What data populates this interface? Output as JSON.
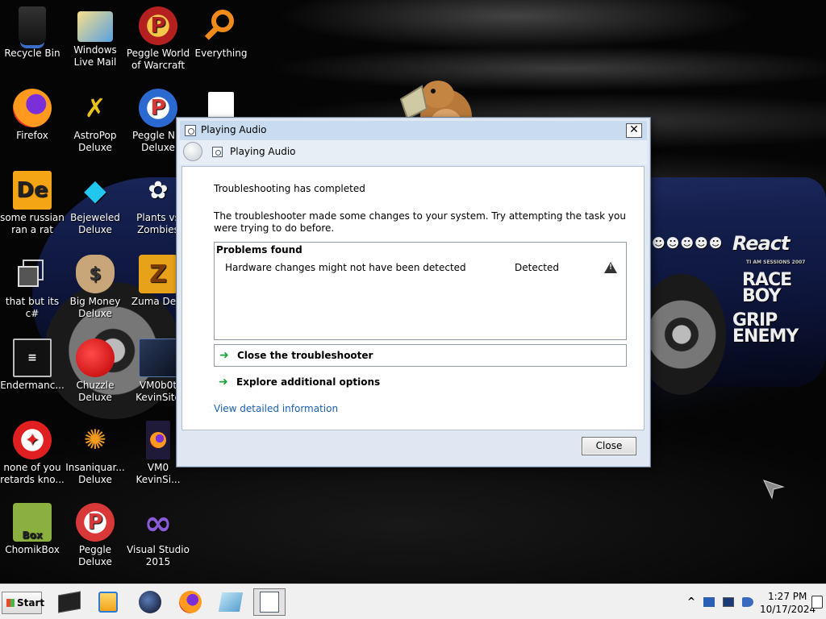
{
  "desktop": {
    "icons": [
      {
        "label": "Recycle Bin",
        "icon": "recycle-bin-icon"
      },
      {
        "label": "Windows Live Mail",
        "icon": "mail-icon"
      },
      {
        "label": "Peggle World of Warcraft ...",
        "icon": "peggle-icon"
      },
      {
        "label": "Everything",
        "icon": "search-icon"
      },
      {
        "label": "Firefox",
        "icon": "firefox-icon"
      },
      {
        "label": "AstroPop Deluxe",
        "icon": "astropop-icon"
      },
      {
        "label": "Peggle Nig Deluxe",
        "icon": "peggle-icon"
      },
      {
        "label": "some russian ran a rat",
        "icon": "de-app-icon"
      },
      {
        "label": "Bejeweled Deluxe",
        "icon": "gem-icon"
      },
      {
        "label": "Plants vs Zombies",
        "icon": "plant-icon"
      },
      {
        "label": "that but its c#",
        "icon": "windows-stack-icon"
      },
      {
        "label": "Big Money Deluxe",
        "icon": "money-bag-icon"
      },
      {
        "label": "Zuma Delu",
        "icon": "zuma-icon"
      },
      {
        "label": "Endermanc...",
        "icon": "terminal-icon"
      },
      {
        "label": "Chuzzle Deluxe",
        "icon": "chuzzle-icon"
      },
      {
        "label": "VM0b0t KevinSite",
        "icon": "vm-icon"
      },
      {
        "label": "none of you retards kno...",
        "icon": "dragon-icon"
      },
      {
        "label": "Insaniquar... Deluxe",
        "icon": "fish-icon"
      },
      {
        "label": "VM0 KevinSi...",
        "icon": "firefox-file-icon"
      },
      {
        "label": "ChomikBox",
        "icon": "chomikbox-icon"
      },
      {
        "label": "Peggle Deluxe",
        "icon": "peggle-icon"
      },
      {
        "label": "Visual Studio 2015",
        "icon": "visual-studio-icon"
      }
    ],
    "wallpaper_decals": {
      "react": "React",
      "react_sub": "TI AM SESSIONS 2007",
      "race_boy": "RACE BOY",
      "grip_enemy": "GRIP ENEMY"
    }
  },
  "dialog": {
    "title": "Playing Audio",
    "nav_title": "Playing Audio",
    "heading": "Troubleshooting has completed",
    "description": "The troubleshooter made some changes to your system. Try attempting the task you were trying to do before.",
    "problems_header": "Problems found",
    "problems": [
      {
        "text": "Hardware changes might not have been detected",
        "status": "Detected"
      }
    ],
    "commands": {
      "close_troubleshooter": "Close the troubleshooter",
      "explore_options": "Explore additional options"
    },
    "view_details": "View detailed information",
    "close_button": "Close",
    "close_x": "✕"
  },
  "taskbar": {
    "start_label": "Start",
    "tray_chevron": "^",
    "clock_time": "1:27 PM",
    "clock_date": "10/17/2024"
  },
  "colors": {
    "link": "#1a5fb4",
    "arrow_green": "#1aa33a",
    "titlebar": "#c9dbef"
  }
}
